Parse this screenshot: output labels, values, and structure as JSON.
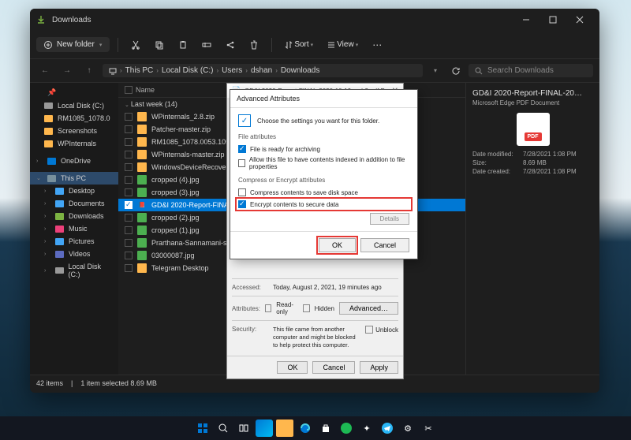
{
  "titlebar": {
    "title": "Downloads"
  },
  "toolbar": {
    "newfolder": "New folder",
    "sort": "Sort",
    "view": "View"
  },
  "path": [
    "This PC",
    "Local Disk (C:)",
    "Users",
    "dshan",
    "Downloads"
  ],
  "search": {
    "placeholder": "Search Downloads"
  },
  "sidebar": {
    "starred": [
      {
        "label": "Local Disk (C:)",
        "type": "drive"
      },
      {
        "label": "RM1085_1078.0",
        "type": "folder"
      },
      {
        "label": "Screenshots",
        "type": "folder"
      },
      {
        "label": "WPInternals",
        "type": "folder"
      }
    ],
    "onedrive": {
      "label": "OneDrive"
    },
    "thispc": {
      "label": "This PC"
    },
    "thispc_items": [
      {
        "label": "Desktop"
      },
      {
        "label": "Documents"
      },
      {
        "label": "Downloads"
      },
      {
        "label": "Music"
      },
      {
        "label": "Pictures"
      },
      {
        "label": "Videos"
      },
      {
        "label": "Local Disk (C:)",
        "type": "drive"
      }
    ]
  },
  "columns": {
    "name": "Name"
  },
  "group": "Last week (14)",
  "files": [
    {
      "name": "WPinternals_2.8.zip",
      "type": "zip"
    },
    {
      "name": "Patcher-master.zip",
      "type": "zip"
    },
    {
      "name": "RM1085_1078.0053.10586.13",
      "type": "folder"
    },
    {
      "name": "WPinternals-master.zip",
      "type": "zip"
    },
    {
      "name": "WindowsDeviceRecoveryTool",
      "type": "zip"
    },
    {
      "name": "cropped (4).jpg",
      "type": "img"
    },
    {
      "name": "cropped (3).jpg",
      "type": "img"
    },
    {
      "name": "GD&I 2020-Report-FINAL-202",
      "type": "pdf",
      "selected": true
    },
    {
      "name": "cropped (2).jpg",
      "type": "img"
    },
    {
      "name": "cropped (1).jpg",
      "type": "img"
    },
    {
      "name": "Prarthana-Sannamani-story-1",
      "type": "img"
    },
    {
      "name": "03000087.jpg",
      "type": "img"
    },
    {
      "name": "Telegram Desktop",
      "type": "folder"
    }
  ],
  "details": {
    "title": "GD&I 2020-Report-FINAL-20…",
    "subtitle": "Microsoft Edge PDF Document",
    "pdf_badge": "PDF",
    "meta": {
      "modified_label": "Date modified:",
      "modified": "7/28/2021 1:08 PM",
      "size_label": "Size:",
      "size": "8.69 MB",
      "created_label": "Date created:",
      "created": "7/28/2021 1:08 PM"
    }
  },
  "statusbar": {
    "count": "42 items",
    "selected": "1 item selected  8.69 MB"
  },
  "props": {
    "title": "GD&I 2020-Report-FINAL-2020-10-19-web2.pdf Prope…",
    "accessed_label": "Accessed:",
    "accessed": "Today, August 2, 2021, 19 minutes ago",
    "attributes_label": "Attributes:",
    "readonly": "Read-only",
    "hidden": "Hidden",
    "advanced": "Advanced…",
    "security_label": "Security:",
    "security": "This file came from another computer and might be blocked to help protect this computer.",
    "unblock": "Unblock",
    "ok": "OK",
    "cancel": "Cancel",
    "apply": "Apply"
  },
  "adv": {
    "title": "Advanced Attributes",
    "banner": "Choose the settings you want for this folder.",
    "section_file": "File attributes",
    "ready": "File is ready for archiving",
    "index": "Allow this file to have contents indexed in addition to file properties",
    "section_compress": "Compress or Encrypt attributes",
    "compress": "Compress contents to save disk space",
    "encrypt": "Encrypt contents to secure data",
    "details": "Details",
    "ok": "OK",
    "cancel": "Cancel"
  }
}
